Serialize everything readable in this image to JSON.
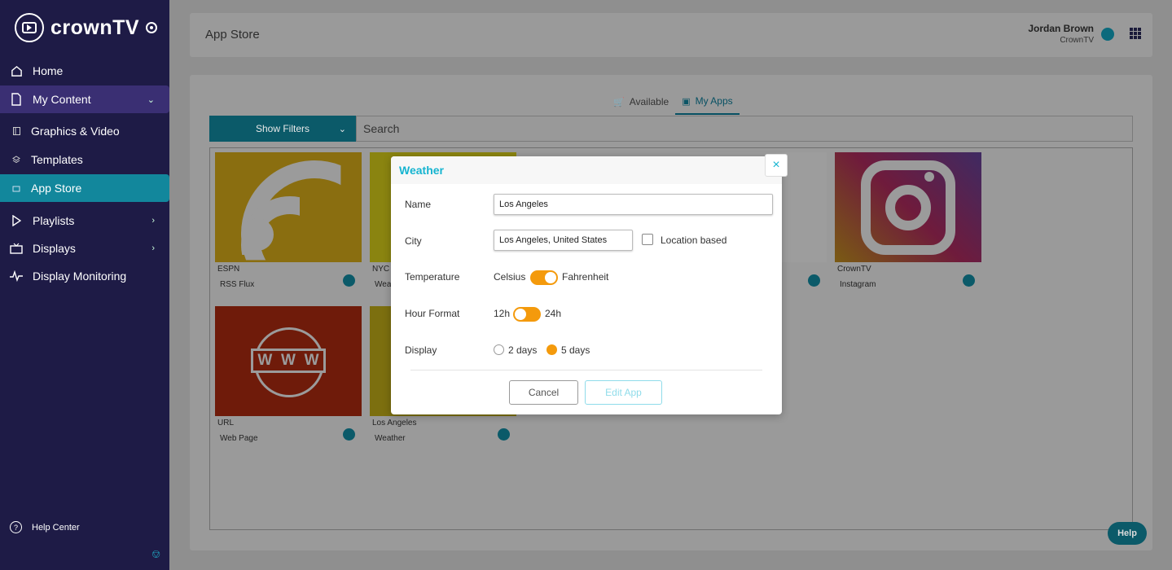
{
  "brand": {
    "name": "crownTV"
  },
  "sidebar": {
    "items": [
      {
        "label": "Home",
        "icon": "home-icon"
      },
      {
        "label": "My Content",
        "icon": "document-icon"
      },
      {
        "label": "Graphics & Video",
        "icon": "film-icon"
      },
      {
        "label": "Templates",
        "icon": "layers-icon"
      },
      {
        "label": "App Store",
        "icon": "store-icon"
      },
      {
        "label": "Playlists",
        "icon": "play-icon"
      },
      {
        "label": "Displays",
        "icon": "tv-icon"
      },
      {
        "label": "Display Monitoring",
        "icon": "pulse-icon"
      }
    ],
    "help_center": "Help Center"
  },
  "header": {
    "title": "App Store",
    "user_name": "Jordan Brown",
    "user_org": "CrownTV"
  },
  "tabs": [
    {
      "label": "Available",
      "active": false
    },
    {
      "label": "My Apps",
      "active": true
    }
  ],
  "filters": {
    "show_filters_label": "Show Filters",
    "search_placeholder": "Search"
  },
  "apps": [
    {
      "owner": "ESPN",
      "name": "RSS Flux"
    },
    {
      "owner": "NYC",
      "name": "Wea"
    },
    {
      "owner": "",
      "name": ""
    },
    {
      "owner": "CrownTV",
      "name": "Instagram"
    },
    {
      "owner": "URL",
      "name": "Web Page"
    },
    {
      "owner": "Los Angeles",
      "name": "Weather"
    }
  ],
  "help_button": "Help",
  "modal": {
    "title": "Weather",
    "name_label": "Name",
    "name_value": "Los Angeles",
    "city_label": "City",
    "city_value": "Los Angeles, United States",
    "location_based_label": "Location based",
    "temperature_label": "Temperature",
    "celsius_label": "Celsius",
    "fahrenheit_label": "Fahrenheit",
    "hour_format_label": "Hour Format",
    "h12_label": "12h",
    "h24_label": "24h",
    "display_label": "Display",
    "two_days_label": "2 days",
    "five_days_label": "5 days",
    "cancel_label": "Cancel",
    "edit_label": "Edit App",
    "close_symbol": "×"
  },
  "colors": {
    "accent": "#15b4d0",
    "orange": "#f49a0c",
    "sidebar": "#1e1b46"
  }
}
